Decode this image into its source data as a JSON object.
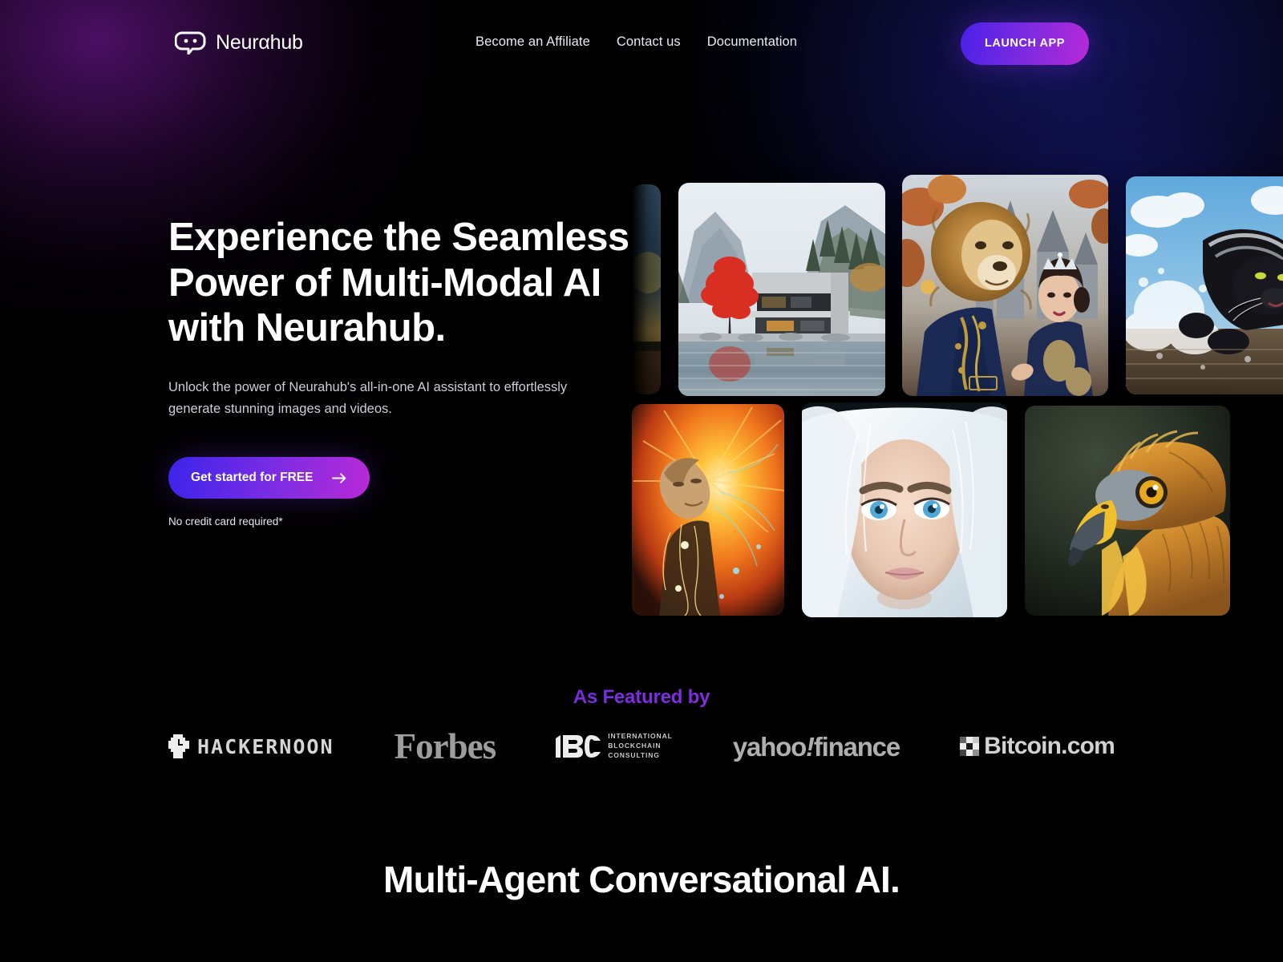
{
  "brand": {
    "name": "Neurαhub",
    "logo_icon": "chat-bubble-face-icon"
  },
  "nav": {
    "items": [
      {
        "label": "Become an Affiliate"
      },
      {
        "label": "Contact us"
      },
      {
        "label": "Documentation"
      }
    ],
    "cta": {
      "label": "LAUNCH APP",
      "gradient_from": "#4a21e8",
      "gradient_to": "#b62ad8"
    }
  },
  "hero": {
    "title_line1": "Experience the Seamless",
    "title_line2": "Power of Multi-Modal AI",
    "title_line3": "with Neurahub.",
    "subtitle": "Unlock the power of Neurahub's all-in-one AI assistant to effortlessly generate stunning images and videos.",
    "cta_label": "Get started for FREE",
    "cta_icon": "arrow-right-icon",
    "cta_note": "No credit card required*",
    "cta_gradient_from": "#3b24ea",
    "cta_gradient_to": "#b92ad6"
  },
  "gallery": {
    "tiles": [
      {
        "name": "partial-left-lake",
        "alt": "Dim teal lake scene partially cropped"
      },
      {
        "name": "modern-house-red-tree",
        "alt": "Modern concrete house by a mountain lake with a red maple tree"
      },
      {
        "name": "lion-king-and-queen",
        "alt": "Lion-headed man in blue embroidered suit beside a crowned woman, castle backdrop"
      },
      {
        "name": "black-panther-water",
        "alt": "Black panther charging through water under a blue sky"
      },
      {
        "name": "energy-figure",
        "alt": "Person with golden electric energy radiating from the body"
      },
      {
        "name": "white-haired-woman",
        "alt": "Close-up portrait of a woman with white hair and blue eyes"
      },
      {
        "name": "golden-eagle",
        "alt": "Golden eagle head in profile with amber eye"
      }
    ]
  },
  "featured": {
    "label": "As Featured by",
    "label_gradient_from": "#3d2ae8",
    "label_gradient_to": "#b22ad6",
    "logos": [
      {
        "name": "hackernoon",
        "text": "HACKERNOON",
        "icon": "pixel-watch-icon"
      },
      {
        "name": "forbes",
        "text": "Forbes"
      },
      {
        "name": "ibc",
        "text": "IBC",
        "line1": "INTERNATIONAL",
        "line2": "BLOCKCHAIN",
        "line3": "CONSULTING"
      },
      {
        "name": "yahoo-finance",
        "text_a": "yahoo",
        "text_b": "!",
        "text_c": "finance"
      },
      {
        "name": "bitcoin-com",
        "text": "Bitcoin.com",
        "icon": "pixel-checker-icon"
      }
    ]
  },
  "section": {
    "title": "Multi-Agent Conversational AI."
  }
}
